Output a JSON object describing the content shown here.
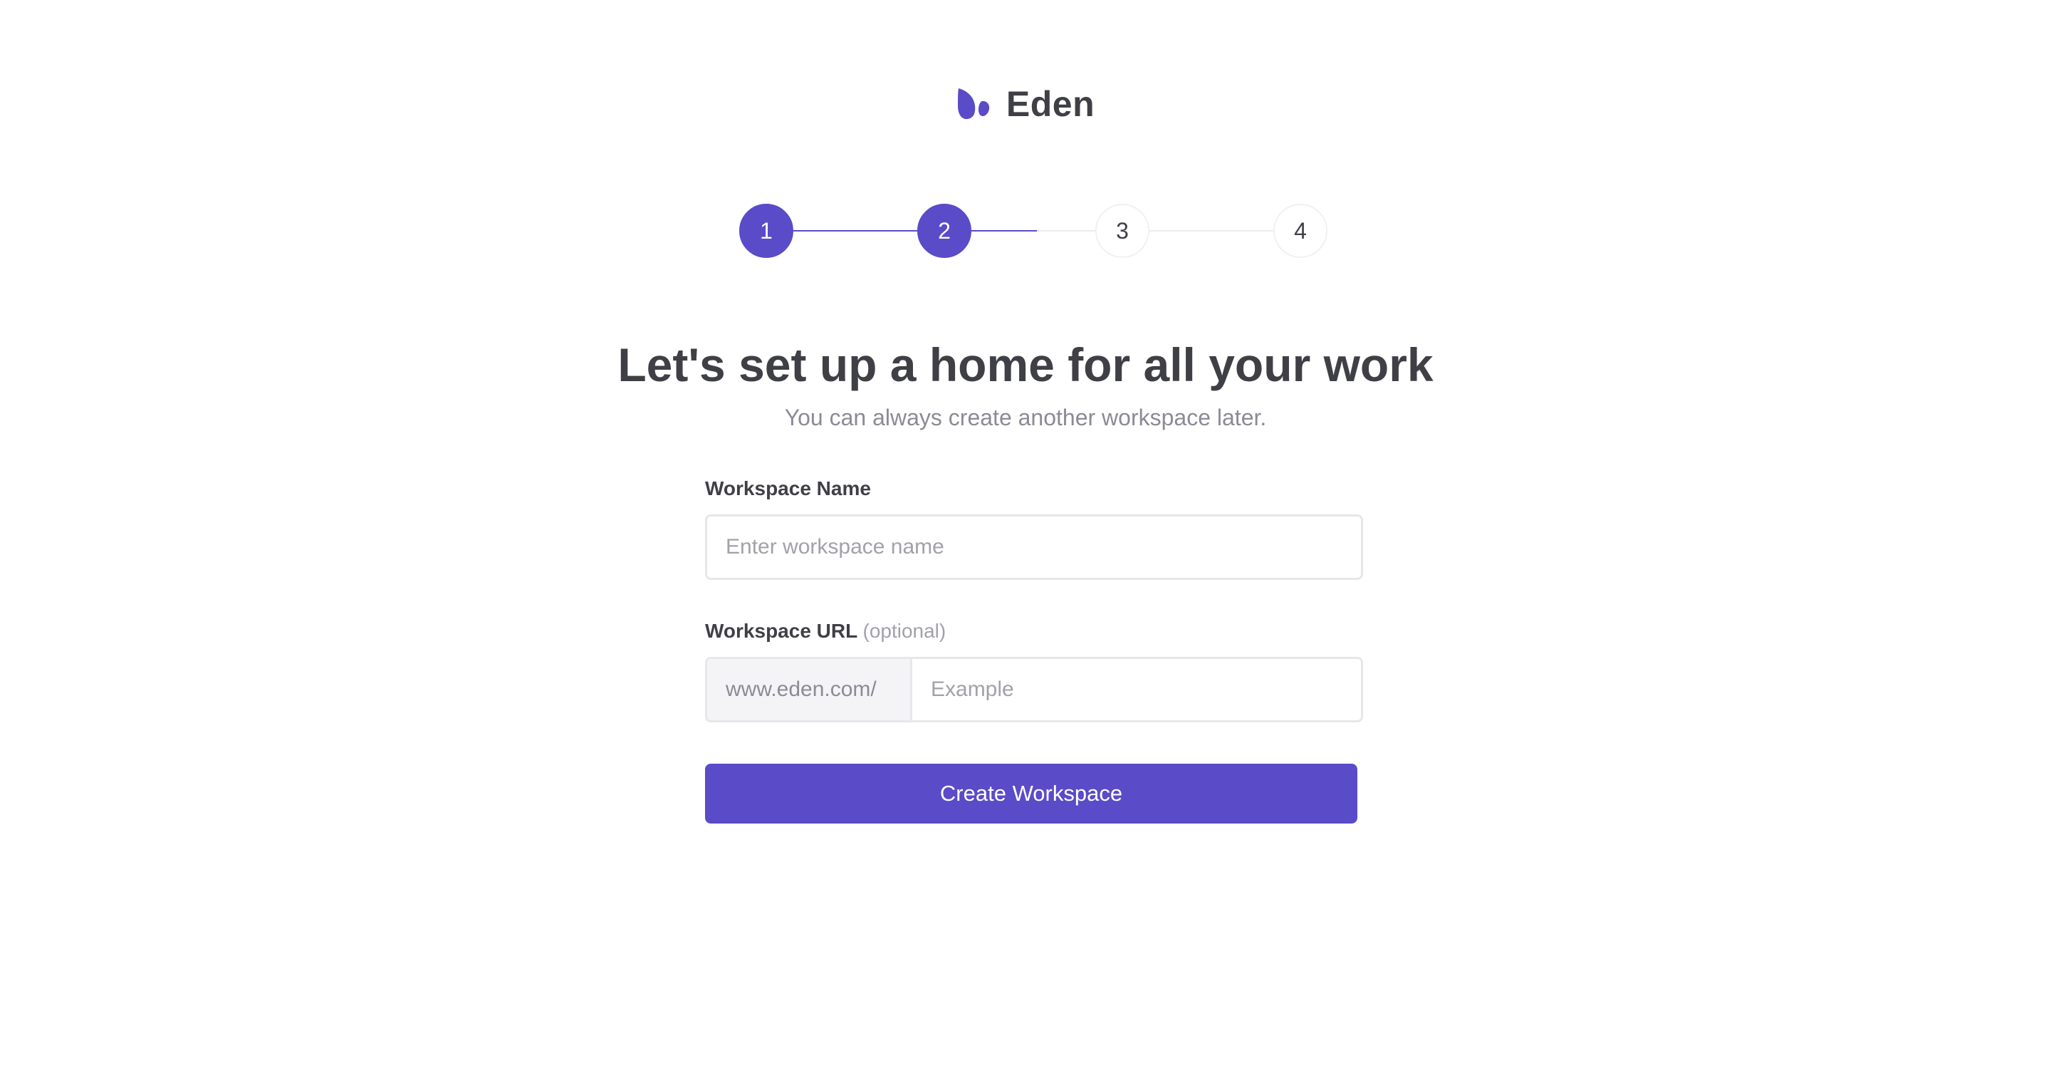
{
  "brand": {
    "name": "Eden",
    "icon": "leaf-logo-icon",
    "color": "#5a4bc8"
  },
  "stepper": {
    "current_step": 2,
    "steps": [
      {
        "label": "1",
        "status": "complete"
      },
      {
        "label": "2",
        "status": "current"
      },
      {
        "label": "3",
        "status": "upcoming"
      },
      {
        "label": "4",
        "status": "upcoming"
      }
    ]
  },
  "heading": {
    "title": "Let's set up a home for all your work",
    "subtitle": "You can always create another workspace later."
  },
  "form": {
    "workspace_name": {
      "label": "Workspace Name",
      "value": "",
      "placeholder": "Enter workspace name"
    },
    "workspace_url": {
      "label": "Workspace URL",
      "optional_text": "(optional)",
      "prefix": "www.eden.com/",
      "value": "",
      "placeholder": "Example"
    },
    "submit_label": "Create Workspace"
  },
  "colors": {
    "accent": "#5a4bc8",
    "text": "#3f3f46",
    "muted": "#8b8b96"
  }
}
